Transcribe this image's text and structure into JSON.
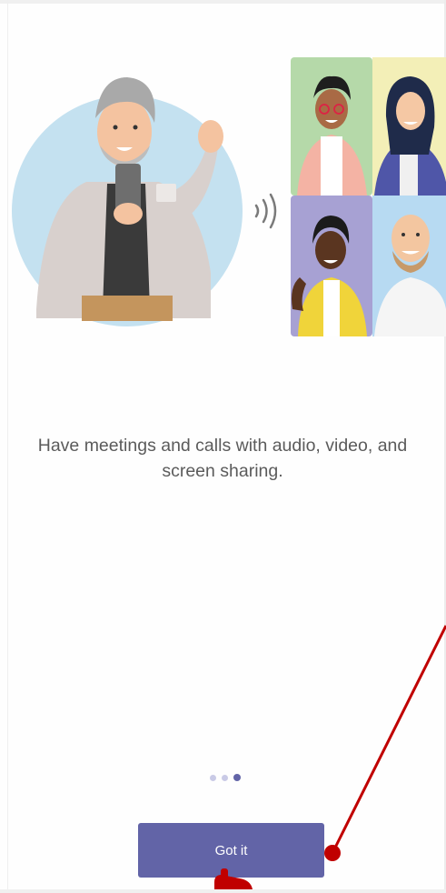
{
  "onboarding": {
    "caption": "Have meetings and calls with audio, video, and screen sharing.",
    "page_indicator": {
      "total": 3,
      "current": 3
    }
  },
  "primary_button": {
    "label": "Got it"
  },
  "colors": {
    "accent": "#6264a7",
    "dot_inactive": "#c9cae6",
    "annotation": "#c00000"
  },
  "icons": {
    "sound_waves": "sound-waves-icon",
    "pointer_hand": "hand-pointer-icon"
  }
}
